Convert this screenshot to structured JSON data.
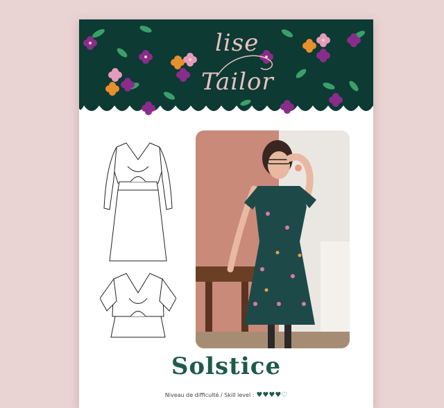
{
  "brand": {
    "line1": "lise",
    "line2": "Tailor"
  },
  "pattern": {
    "name": "Solstice"
  },
  "skill": {
    "label": "Niveau de difficulté / Skill level :",
    "hearts": "♥♥♥♥♡"
  },
  "colors": {
    "banner": "#0d3a33",
    "title": "#1e5a4a",
    "background": "#e9d3d3",
    "brand_text": "#e8c1c1"
  },
  "icons": [
    "floral-banner",
    "dress-sketch",
    "blouse-sketch",
    "model-photo"
  ]
}
